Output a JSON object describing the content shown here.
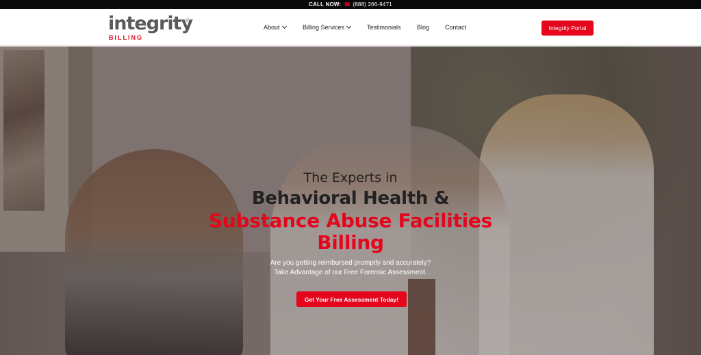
{
  "topbar": {
    "label": "CALL NOW:",
    "phone_icon": "phone-icon",
    "phone": "(888) 266-9471"
  },
  "header": {
    "logo": {
      "word": "integrity",
      "registered": "®",
      "sub": "BILLING"
    },
    "nav": [
      {
        "label": "About",
        "has_dropdown": true
      },
      {
        "label": "Billing Services",
        "has_dropdown": true
      },
      {
        "label": "Testimonials",
        "has_dropdown": false
      },
      {
        "label": "Blog",
        "has_dropdown": false
      },
      {
        "label": "Contact",
        "has_dropdown": false
      }
    ],
    "portal_button": "Integrity Portal"
  },
  "hero": {
    "pre_title": "The Experts in",
    "title_main": "Behavioral Health &",
    "title_accent_line1": "Substance Abuse Facilities",
    "title_accent_line2": "Billing",
    "subtitle_line1": "Are you getting reimbursed promptly and accurately?",
    "subtitle_line2": "Take Advantage of our Free Forensic Assessment.",
    "cta": "Get Your Free Assessment Today!"
  },
  "colors": {
    "accent": "#e3061c",
    "topbar_bg": "#0a0a0a",
    "text_dark": "#222222",
    "logo_gray": "#5a5a5a"
  }
}
